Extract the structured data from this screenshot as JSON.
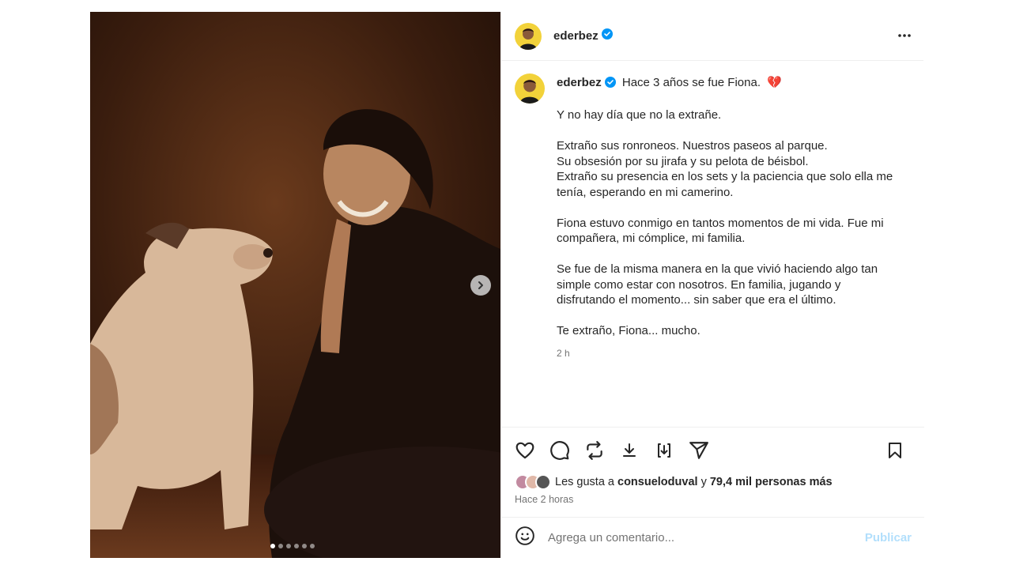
{
  "author": {
    "username": "ederbez",
    "verified": true
  },
  "caption": {
    "first_line": "Hace 3 años se fue Fiona.",
    "emoji": "💔",
    "paragraphs": [
      "Y no hay día que no la extrañe.",
      "Extraño sus ronroneos. Nuestros paseos al parque.\nSu obsesión por su jirafa y su pelota de béisbol.\nExtraño su presencia en los sets y la paciencia que solo ella me\ntenía, esperando en mi camerino.",
      "Fiona estuvo conmigo en tantos momentos de mi vida. Fue mi\ncompañera, mi cómplice, mi familia.",
      "Se fue de la misma manera en la que vivió haciendo algo tan\nsimple como estar con nosotros. En familia, jugando y\ndisfrutando el momento... sin saber que era el último.",
      "Te extraño, Fiona... mucho."
    ],
    "time_ago": "2 h"
  },
  "media": {
    "carousel_count": 6,
    "carousel_index": 1
  },
  "actions": {
    "icons": [
      "heart-icon",
      "comment-icon",
      "repost-icon",
      "download-icon",
      "share-alt-icon",
      "send-icon",
      "bookmark-icon"
    ]
  },
  "likes": {
    "prefix": "Les gusta a",
    "user": "consueloduval",
    "connector": "y",
    "others": "79,4 mil personas más"
  },
  "posted": "Hace 2 horas",
  "comment": {
    "placeholder": "Agrega un comentario...",
    "publish_label": "Publicar"
  },
  "colors": {
    "verified": "#0095f6",
    "publish_disabled": "#b2dffc",
    "muted": "#737373"
  }
}
